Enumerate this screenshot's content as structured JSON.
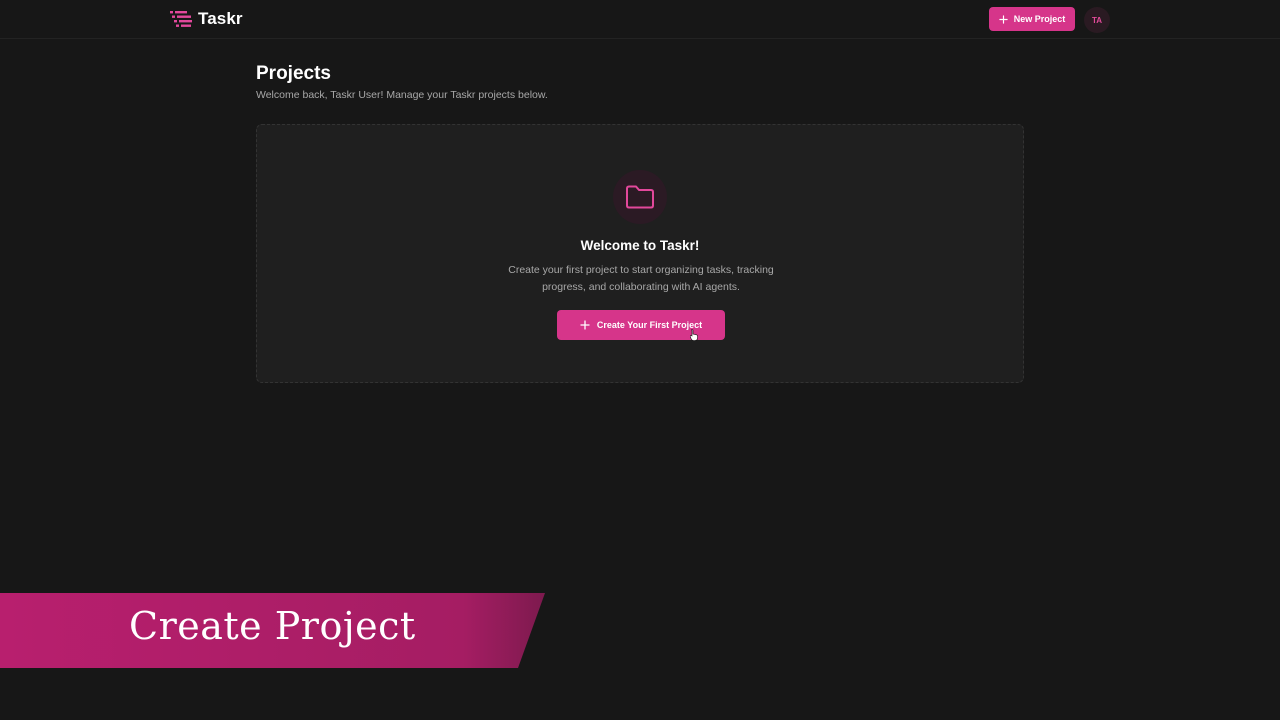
{
  "app": {
    "name": "Taskr",
    "logo_icon": "list-lines-icon"
  },
  "header": {
    "new_project_label": "New Project",
    "avatar_initials": "TA"
  },
  "main": {
    "title": "Projects",
    "subtitle": "Welcome back, Taskr User! Manage your Taskr projects below."
  },
  "empty_state": {
    "icon": "folder-icon",
    "title": "Welcome to Taskr!",
    "description": "Create your first project to start organizing tasks, tracking progress, and collaborating with AI agents.",
    "cta_label": "Create Your First Project"
  },
  "caption": {
    "text": "Create Project"
  },
  "colors": {
    "accent": "#d6358a",
    "background": "#171717",
    "card": "#1f1f1f",
    "banner": "#b01e6a"
  }
}
